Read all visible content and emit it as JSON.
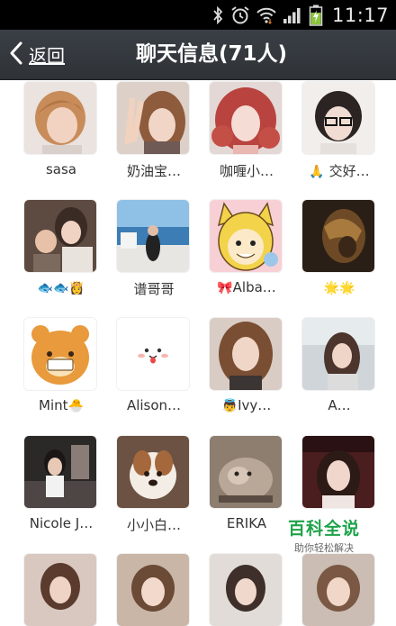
{
  "status_bar": {
    "time": "11:17",
    "icons": [
      "bluetooth-icon",
      "alarm-icon",
      "wifi-icon",
      "signal-icon",
      "battery-charging-icon"
    ]
  },
  "header": {
    "back_label": "返回",
    "title": "聊天信息(71人)"
  },
  "members": [
    {
      "name": "sasa",
      "emoji": "",
      "avatar": "portrait-short-hair"
    },
    {
      "name": "奶油宝…",
      "emoji": "",
      "avatar": "portrait-peace-sign"
    },
    {
      "name": "咖喱小…",
      "emoji": "",
      "avatar": "portrait-pink-curls"
    },
    {
      "name": "交好…",
      "emoji": "🙏",
      "avatar": "portrait-glasses"
    },
    {
      "name": "",
      "emoji": "🐟🐟👸",
      "avatar": "photo-mother-child"
    },
    {
      "name": "谱哥哥",
      "emoji": "",
      "avatar": "photo-seaside"
    },
    {
      "name": "Alba…",
      "emoji": "🎀",
      "avatar": "cartoon-cat-girl"
    },
    {
      "name": "",
      "emoji": "🌟🌟",
      "avatar": "photo-dark-mask"
    },
    {
      "name": "Mint",
      "emoji": "🐣",
      "avatar": "cartoon-rilakkuma"
    },
    {
      "name": "Alison…",
      "emoji": "",
      "avatar": "cartoon-line-face"
    },
    {
      "name": "Ivy…",
      "emoji": "👼",
      "avatar": "portrait-wavy-hair"
    },
    {
      "name": "A…",
      "emoji": "",
      "avatar": "portrait-outdoor"
    },
    {
      "name": "Nicole J…",
      "emoji": "",
      "avatar": "photo-studio"
    },
    {
      "name": "小小白…",
      "emoji": "",
      "avatar": "photo-puppy"
    },
    {
      "name": "ERIKA",
      "emoji": "",
      "avatar": "photo-cat-sepia"
    },
    {
      "name": "",
      "emoji": "",
      "avatar": "portrait-dark-red"
    },
    {
      "name": "",
      "emoji": "",
      "avatar": "partial-1"
    },
    {
      "name": "",
      "emoji": "",
      "avatar": "partial-2"
    },
    {
      "name": "",
      "emoji": "",
      "avatar": "partial-3"
    },
    {
      "name": "",
      "emoji": "",
      "avatar": "partial-4"
    }
  ],
  "watermark": {
    "title": "百科全说",
    "subtitle": "助你轻松解决"
  },
  "colors": {
    "status_bar": "#000000",
    "title_bar": "#34393e",
    "watermark_green": "#1fa34a"
  }
}
